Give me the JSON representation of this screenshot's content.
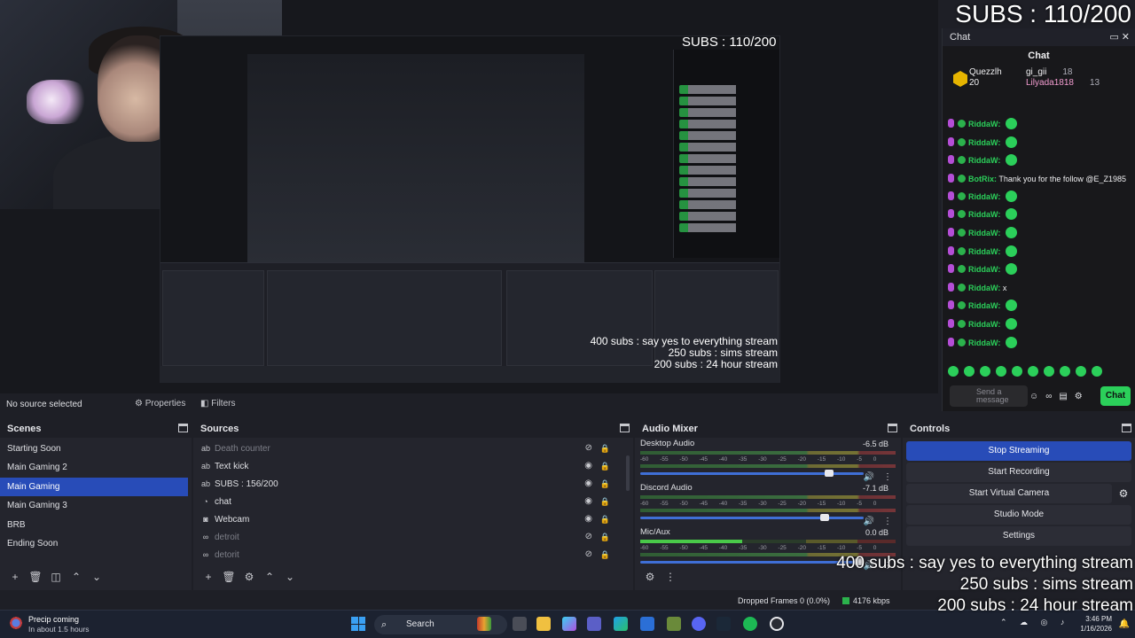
{
  "overlay": {
    "subs_counter": "SUBS : 110/200",
    "goals": [
      "400 subs : say yes to everything stream",
      "250 subs : sims stream",
      "200 subs : 24 hour stream"
    ]
  },
  "preview": {
    "nested_subs": "SUBS : 110/200",
    "nested_goals": [
      "400 subs : say yes to everything stream",
      "250 subs : sims stream",
      "200 subs : 24 hour stream"
    ]
  },
  "chat_dock": {
    "title": "Chat",
    "heading": "Chat",
    "leaders": [
      {
        "name": "Quezzlh",
        "count": "20"
      },
      {
        "name": "gi_gii",
        "count": "18"
      },
      {
        "name": "Lilyada1818",
        "count": "13"
      }
    ],
    "messages": [
      {
        "user": "RiddaW:",
        "text": ""
      },
      {
        "user": "RiddaW:",
        "text": ""
      },
      {
        "user": "RiddaW:",
        "text": ""
      },
      {
        "user": "BotRix:",
        "text": "Thank you for the follow @E_Z1985",
        "bot": true
      },
      {
        "user": "RiddaW:",
        "text": ""
      },
      {
        "user": "RiddaW:",
        "text": ""
      },
      {
        "user": "RiddaW:",
        "text": ""
      },
      {
        "user": "RiddaW:",
        "text": ""
      },
      {
        "user": "RiddaW:",
        "text": ""
      },
      {
        "user": "RiddaW:",
        "text": "x"
      },
      {
        "user": "RiddaW:",
        "text": ""
      },
      {
        "user": "RiddaW:",
        "text": ""
      },
      {
        "user": "RiddaW:",
        "text": ""
      }
    ],
    "input_placeholder": "Send a message",
    "send_label": "Chat"
  },
  "context_bar": {
    "no_source": "No source selected",
    "properties": "Properties",
    "filters": "Filters"
  },
  "scenes": {
    "title": "Scenes",
    "items": [
      "Starting Soon",
      "Main Gaming 2",
      "Main Gaming",
      "Main Gaming 3",
      "BRB",
      "Ending Soon"
    ],
    "selected": "Main Gaming"
  },
  "sources": {
    "title": "Sources",
    "items": [
      {
        "name": "Death counter",
        "icon": "text-icon",
        "visible": false
      },
      {
        "name": "Text kick",
        "icon": "text-icon",
        "visible": true
      },
      {
        "name": "SUBS : 156/200",
        "icon": "text-icon",
        "visible": true
      },
      {
        "name": "chat",
        "icon": "browser-icon",
        "visible": true
      },
      {
        "name": "Webcam",
        "icon": "camera-icon",
        "visible": true
      },
      {
        "name": "detroit",
        "icon": "link-icon",
        "visible": false
      },
      {
        "name": "detorit",
        "icon": "link-icon",
        "visible": false
      }
    ]
  },
  "audio_mixer": {
    "title": "Audio Mixer",
    "scale": "-60 -55 -50 -45 -40 -35 -30 -25 -20 -15 -10 -5 0",
    "channels": [
      {
        "name": "Desktop Audio",
        "db": "-6.5 dB",
        "level": 0.86
      },
      {
        "name": "Discord Audio",
        "db": "-7.1 dB",
        "level": 0.84
      },
      {
        "name": "Mic/Aux",
        "db": "0.0 dB",
        "level": 1.0
      }
    ]
  },
  "controls": {
    "title": "Controls",
    "buttons": [
      "Stop Streaming",
      "Start Recording",
      "Start Virtual Camera",
      "Studio Mode",
      "Settings"
    ]
  },
  "status": {
    "dropped": "Dropped Frames 0 (0.0%)",
    "kbps": "4176 kbps"
  },
  "taskbar": {
    "weather_title": "Precip coming",
    "weather_sub": "In about 1.5 hours",
    "search": "Search",
    "time": "3:46 PM",
    "date": "1/16/2026"
  },
  "colors": {
    "accent": "#284cb8",
    "chat_green": "#2bcf5a"
  }
}
